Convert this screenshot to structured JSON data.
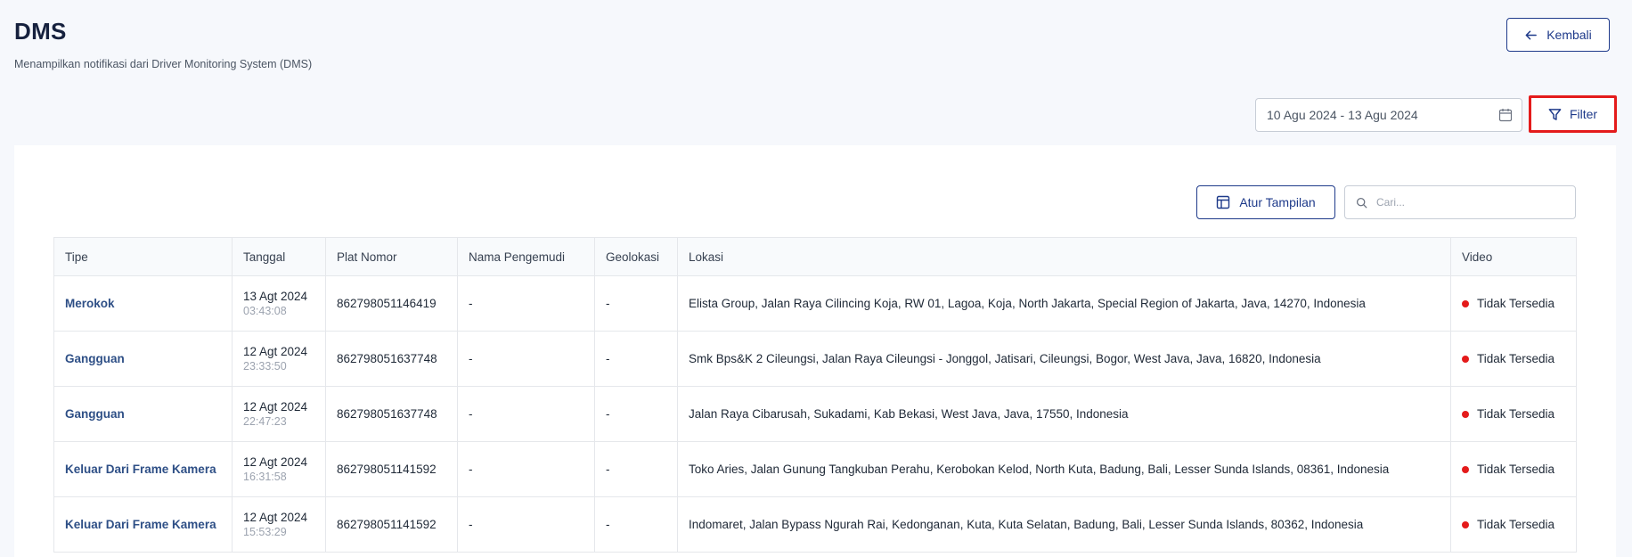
{
  "header": {
    "title": "DMS",
    "subtitle": "Menampilkan notifikasi dari Driver Monitoring System (DMS)",
    "back_label": "Kembali"
  },
  "filters": {
    "date_range": "10 Agu 2024 - 13 Agu 2024",
    "filter_label": "Filter"
  },
  "toolbar": {
    "atur_label": "Atur Tampilan",
    "search_placeholder": "Cari..."
  },
  "table": {
    "columns": [
      "Tipe",
      "Tanggal",
      "Plat Nomor",
      "Nama Pengemudi",
      "Geolokasi",
      "Lokasi",
      "Video"
    ],
    "rows": [
      {
        "tipe": "Merokok",
        "date": "13 Agt 2024",
        "time": "03:43:08",
        "plat": "862798051146419",
        "pengemudi": "-",
        "geolokasi": "-",
        "lokasi": "Elista Group, Jalan Raya Cilincing Koja, RW 01, Lagoa, Koja, North Jakarta, Special Region of Jakarta, Java, 14270, Indonesia",
        "video": "Tidak Tersedia"
      },
      {
        "tipe": "Gangguan",
        "date": "12 Agt 2024",
        "time": "23:33:50",
        "plat": "862798051637748",
        "pengemudi": "-",
        "geolokasi": "-",
        "lokasi": "Smk Bps&K 2 Cileungsi, Jalan Raya Cileungsi - Jonggol, Jatisari, Cileungsi, Bogor, West Java, Java, 16820, Indonesia",
        "video": "Tidak Tersedia"
      },
      {
        "tipe": "Gangguan",
        "date": "12 Agt 2024",
        "time": "22:47:23",
        "plat": "862798051637748",
        "pengemudi": "-",
        "geolokasi": "-",
        "lokasi": "Jalan Raya Cibarusah, Sukadami, Kab Bekasi, West Java, Java, 17550, Indonesia",
        "video": "Tidak Tersedia"
      },
      {
        "tipe": "Keluar Dari Frame Kamera",
        "date": "12 Agt 2024",
        "time": "16:31:58",
        "plat": "862798051141592",
        "pengemudi": "-",
        "geolokasi": "-",
        "lokasi": "Toko Aries, Jalan Gunung Tangkuban Perahu, Kerobokan Kelod, North Kuta, Badung, Bali, Lesser Sunda Islands, 08361, Indonesia",
        "video": "Tidak Tersedia"
      },
      {
        "tipe": "Keluar Dari Frame Kamera",
        "date": "12 Agt 2024",
        "time": "15:53:29",
        "plat": "862798051141592",
        "pengemudi": "-",
        "geolokasi": "-",
        "lokasi": "Indomaret, Jalan Bypass Ngurah Rai, Kedonganan, Kuta, Kuta Selatan, Badung, Bali, Lesser Sunda Islands, 80362, Indonesia",
        "video": "Tidak Tersedia"
      }
    ]
  },
  "colors": {
    "primary": "#1e3a8a",
    "highlight_border": "#e41b1b",
    "status_dot": "#e41b1b",
    "tipe_link": "#2e4f86"
  },
  "icons": {
    "back": "arrow-left-icon",
    "calendar": "calendar-icon",
    "filter": "funnel-icon",
    "atur": "layout-columns-icon",
    "search": "search-icon"
  }
}
